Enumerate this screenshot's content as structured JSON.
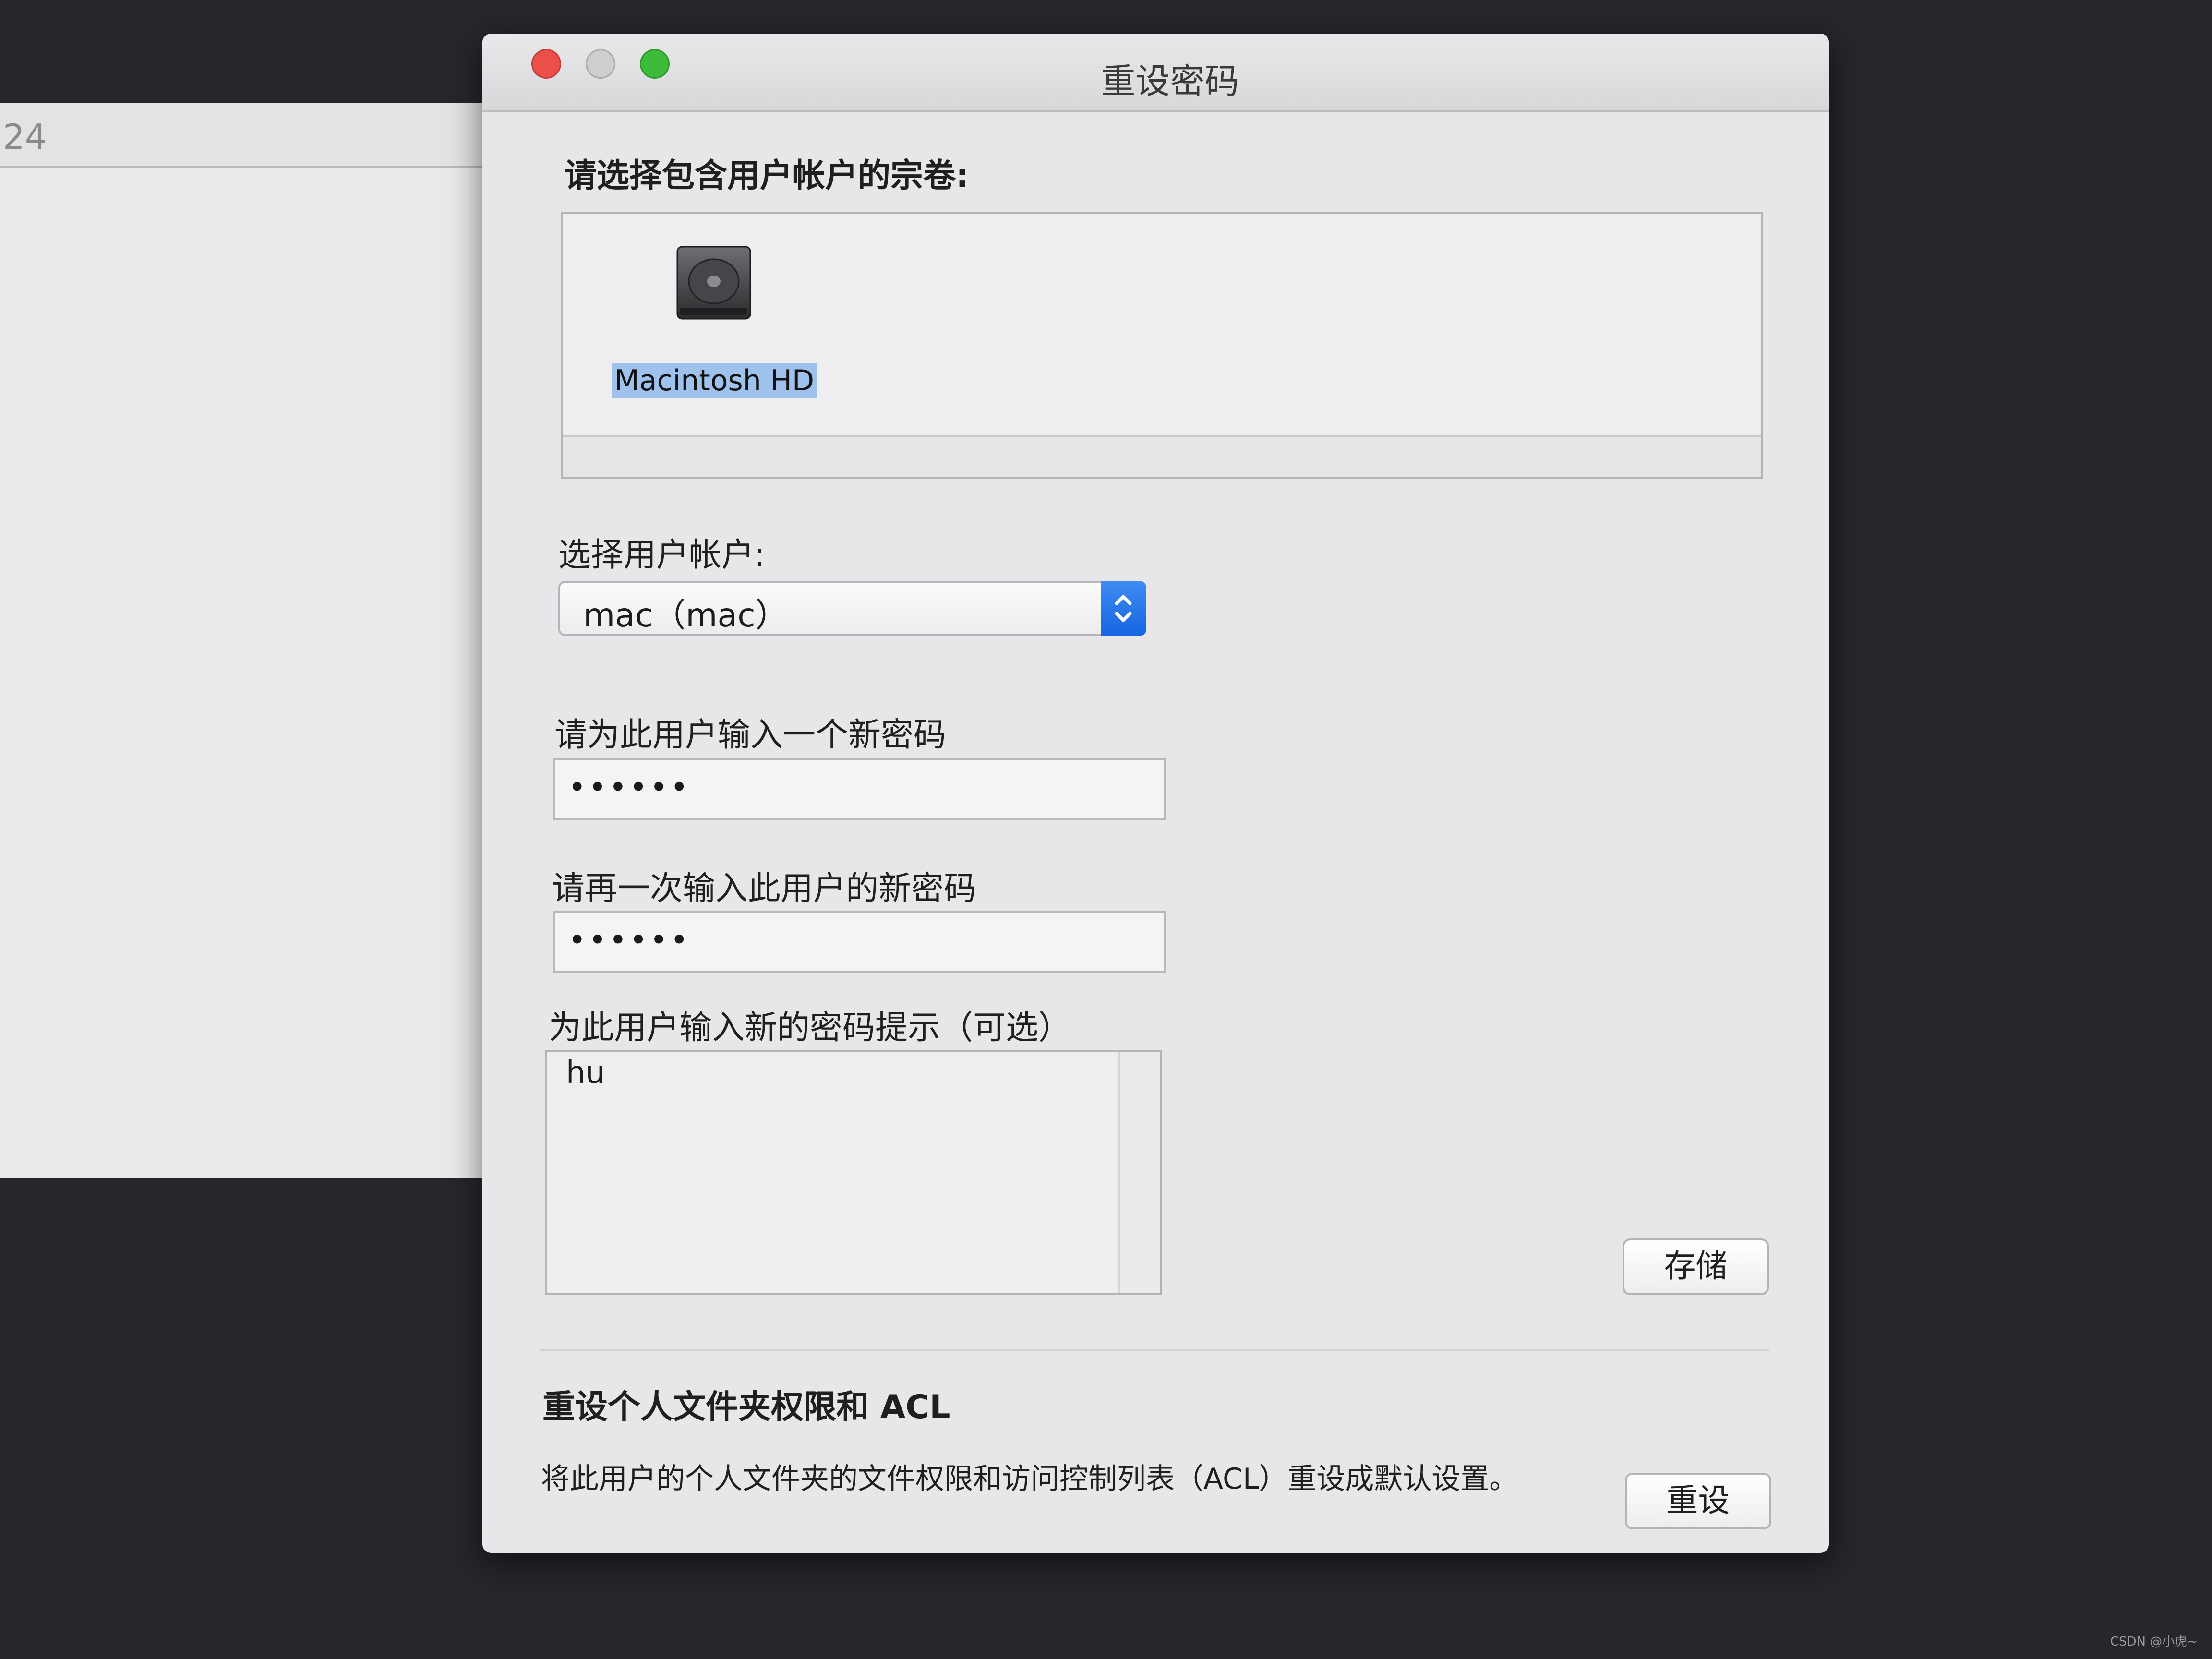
{
  "background_window": {
    "toolbar_text": "24"
  },
  "dialog": {
    "title": "重设密码",
    "volume_section_label": "请选择包含用户帐户的宗卷:",
    "volume": {
      "name": "Macintosh HD",
      "icon": "hard-drive-icon"
    },
    "user_section_label": "选择用户帐户:",
    "user_select": {
      "value": "mac（mac）"
    },
    "new_password_label": "请为此用户输入一个新密码",
    "new_password_value": "••••••",
    "verify_password_label": "请再一次输入此用户的新密码",
    "verify_password_value": "••••••",
    "hint_label": "为此用户输入新的密码提示（可选）",
    "hint_value": "hu",
    "save_button": "存储",
    "acl_title": "重设个人文件夹权限和 ACL",
    "acl_description": "将此用户的个人文件夹的文件权限和访问控制列表（ACL）重设成默认设置。",
    "reset_button": "重设"
  },
  "watermark": "CSDN @小虎~",
  "colors": {
    "close": "#ec4f47",
    "zoom": "#3dbb3b",
    "accent": "#1565e0",
    "selection": "#9ec2ec"
  }
}
